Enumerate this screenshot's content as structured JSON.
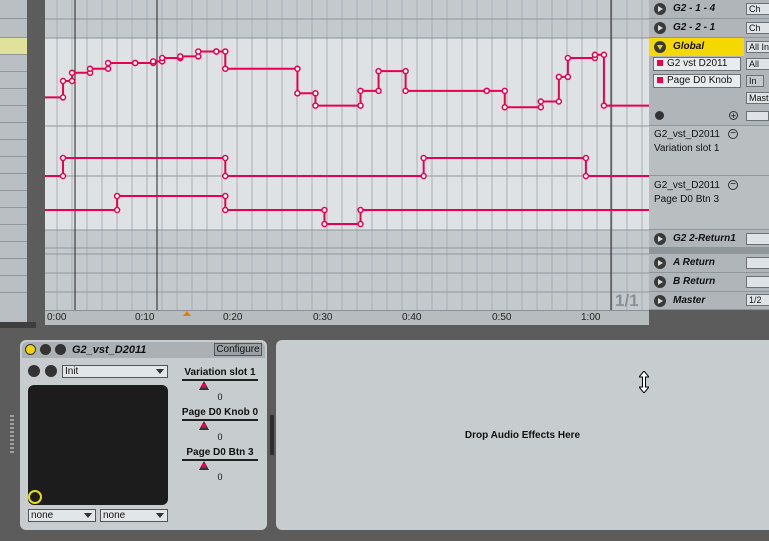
{
  "tracks": {
    "g2_1_4": "G2 - 1 - 4",
    "g2_2_1": "G2 - 2 - 1",
    "global": "Global",
    "g2_2_return1": "G2 2-Return1",
    "a_return": "A Return",
    "b_return": "B Return",
    "master": "Master"
  },
  "mini": {
    "ch_1": "Ch",
    "ch_2": "Ch",
    "all_in": "All In",
    "all": "All",
    "in": "In",
    "mast": "Mast",
    "master_val": "1/2"
  },
  "global_lane": {
    "device_select": "G2 vst D2011",
    "param_select": "Page D0 Knob"
  },
  "lanes": [
    {
      "device": "G2_vst_D2011",
      "param": "Variation slot 1"
    },
    {
      "device": "G2_vst_D2011",
      "param": "Page D0 Btn 3"
    }
  ],
  "loop_indicator": "1/1",
  "timeline": [
    "0:00",
    "0:10",
    "0:20",
    "0:30",
    "0:40",
    "0:50",
    "1:00"
  ],
  "device": {
    "name": "G2_vst_D2011",
    "configure": "Configure",
    "preset": "Init",
    "xy_x": "none",
    "xy_y": "none",
    "macros": [
      {
        "label": "Variation slot 1",
        "value": "0"
      },
      {
        "label": "Page D0 Knob 0",
        "value": "0"
      },
      {
        "label": "Page D0 Btn 3",
        "value": "0"
      }
    ]
  },
  "fx_drop": "Drop Audio Effects Here",
  "colors": {
    "automation": "#e8004d",
    "global_highlight": "#f5d800",
    "arrangement_bg": "#c9ced1",
    "lane_bg": "#dfe2e4"
  },
  "chart_data": {
    "type": "line",
    "series": [
      {
        "values": [
          [
            0,
            0.3
          ],
          [
            2,
            0.3
          ],
          [
            2,
            0.5
          ],
          [
            3,
            0.5
          ],
          [
            3,
            0.6
          ],
          [
            5,
            0.6
          ],
          [
            5,
            0.65
          ],
          [
            7,
            0.65
          ],
          [
            7,
            0.72
          ],
          [
            10,
            0.72
          ],
          [
            10,
            0.72
          ],
          [
            12,
            0.72
          ],
          [
            12,
            0.74
          ],
          [
            13,
            0.74
          ],
          [
            13,
            0.78
          ],
          [
            15,
            0.78
          ],
          [
            15,
            0.8
          ],
          [
            17,
            0.8
          ],
          [
            17,
            0.86
          ],
          [
            19,
            0.86
          ],
          [
            19,
            0.86
          ],
          [
            20,
            0.86
          ],
          [
            20,
            0.65
          ],
          [
            28,
            0.65
          ],
          [
            28,
            0.35
          ],
          [
            30,
            0.35
          ],
          [
            30,
            0.2
          ],
          [
            35,
            0.2
          ],
          [
            35,
            0.38
          ],
          [
            37,
            0.38
          ],
          [
            37,
            0.62
          ],
          [
            40,
            0.62
          ],
          [
            40,
            0.38
          ],
          [
            49,
            0.38
          ],
          [
            49,
            0.38
          ],
          [
            51,
            0.38
          ],
          [
            51,
            0.18
          ],
          [
            55,
            0.18
          ],
          [
            55,
            0.25
          ],
          [
            57,
            0.25
          ],
          [
            57,
            0.55
          ],
          [
            58,
            0.55
          ],
          [
            58,
            0.78
          ],
          [
            61,
            0.78
          ],
          [
            61,
            0.82
          ],
          [
            62,
            0.82
          ],
          [
            62,
            0.2
          ],
          [
            67,
            0.2
          ]
        ]
      },
      {
        "values": [
          [
            0,
            0
          ],
          [
            2,
            0
          ],
          [
            2,
            1
          ],
          [
            20,
            1
          ],
          [
            20,
            0
          ],
          [
            42,
            0
          ],
          [
            42,
            1
          ],
          [
            60,
            1
          ],
          [
            60,
            0
          ],
          [
            67,
            0
          ]
        ]
      },
      {
        "values": [
          [
            0,
            0.5
          ],
          [
            8,
            0.5
          ],
          [
            8,
            1
          ],
          [
            20,
            1
          ],
          [
            20,
            0.5
          ],
          [
            31,
            0.5
          ],
          [
            31,
            0
          ],
          [
            35,
            0
          ],
          [
            35,
            0.5
          ],
          [
            67,
            0.5
          ]
        ]
      }
    ]
  }
}
